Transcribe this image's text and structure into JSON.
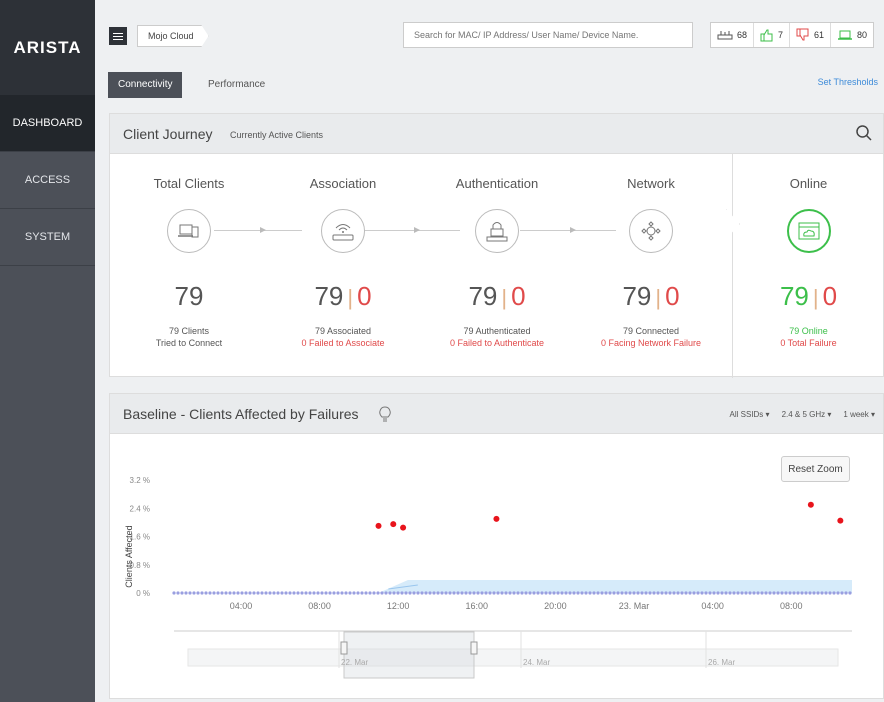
{
  "sidebar": {
    "logo": "ARISTA",
    "items": [
      {
        "label": "DASHBOARD"
      },
      {
        "label": "ACCESS"
      },
      {
        "label": "SYSTEM"
      }
    ]
  },
  "topbar": {
    "breadcrumb": "Mojo Cloud",
    "search_placeholder": "Search for MAC/ IP Address/ User Name/ Device Name.",
    "stats": [
      {
        "icon": "access-point-icon",
        "value": "68",
        "color": "#555555"
      },
      {
        "icon": "thumbs-up-icon",
        "value": "7",
        "color": "#3cbf4a"
      },
      {
        "icon": "thumbs-down-icon",
        "value": "61",
        "color": "#e04a4a"
      },
      {
        "icon": "laptop-icon",
        "value": "80",
        "color": "#3cbf4a"
      }
    ]
  },
  "tabs": {
    "items": [
      {
        "label": "Connectivity"
      },
      {
        "label": "Performance"
      }
    ],
    "set_thresholds": "Set Thresholds"
  },
  "journey": {
    "title": "Client Journey",
    "subtitle": "Currently Active Clients",
    "stages": [
      {
        "title": "Total Clients",
        "count": "79",
        "fail": "",
        "line1": "79 Clients",
        "line2": "Tried to Connect",
        "icon": "devices-icon"
      },
      {
        "title": "Association",
        "count": "79",
        "fail": "0",
        "line1": "79 Associated",
        "line2": "0 Failed to Associate",
        "icon": "wifi-router-icon"
      },
      {
        "title": "Authentication",
        "count": "79",
        "fail": "0",
        "line1": "79 Authenticated",
        "line2": "0 Failed to Authenticate",
        "icon": "lock-icon"
      },
      {
        "title": "Network",
        "count": "79",
        "fail": "0",
        "line1": "79 Connected",
        "line2": "0 Facing Network Failure",
        "icon": "network-gear-icon"
      }
    ],
    "online": {
      "title": "Online",
      "count": "79",
      "fail": "0",
      "line1": "79 Online",
      "line2": "0 Total Failure",
      "icon": "cloud-window-icon"
    }
  },
  "baseline": {
    "title": "Baseline - Clients Affected by Failures",
    "filters": {
      "ssid": "All SSIDs",
      "band": "2.4 & 5 GHz",
      "range": "1 week"
    },
    "reset_zoom": "Reset Zoom"
  },
  "chart_data": {
    "type": "scatter",
    "ylabel": "Clients Affected",
    "ylim": [
      0,
      3.2
    ],
    "y_ticks": [
      "0 %",
      "0.8 %",
      "1.6 %",
      "2.4 %",
      "3.2 %"
    ],
    "x_ticks": [
      "04:00",
      "08:00",
      "12:00",
      "16:00",
      "20:00",
      "23. Mar",
      "04:00",
      "08:00"
    ],
    "points": [
      {
        "x": "11:00",
        "y": 1.9
      },
      {
        "x": "11:45",
        "y": 1.95
      },
      {
        "x": "12:15",
        "y": 1.85
      },
      {
        "x": "17:00",
        "y": 2.1
      },
      {
        "x": "23. Mar 09:00",
        "y": 2.5
      },
      {
        "x": "23. Mar 10:30",
        "y": 2.05
      }
    ],
    "navigator_ticks": [
      "22. Mar",
      "24. Mar",
      "26. Mar"
    ],
    "colors": {
      "points": "#e8141c",
      "baseline": "#9a9fe0",
      "band": "#d6ebfa"
    }
  }
}
